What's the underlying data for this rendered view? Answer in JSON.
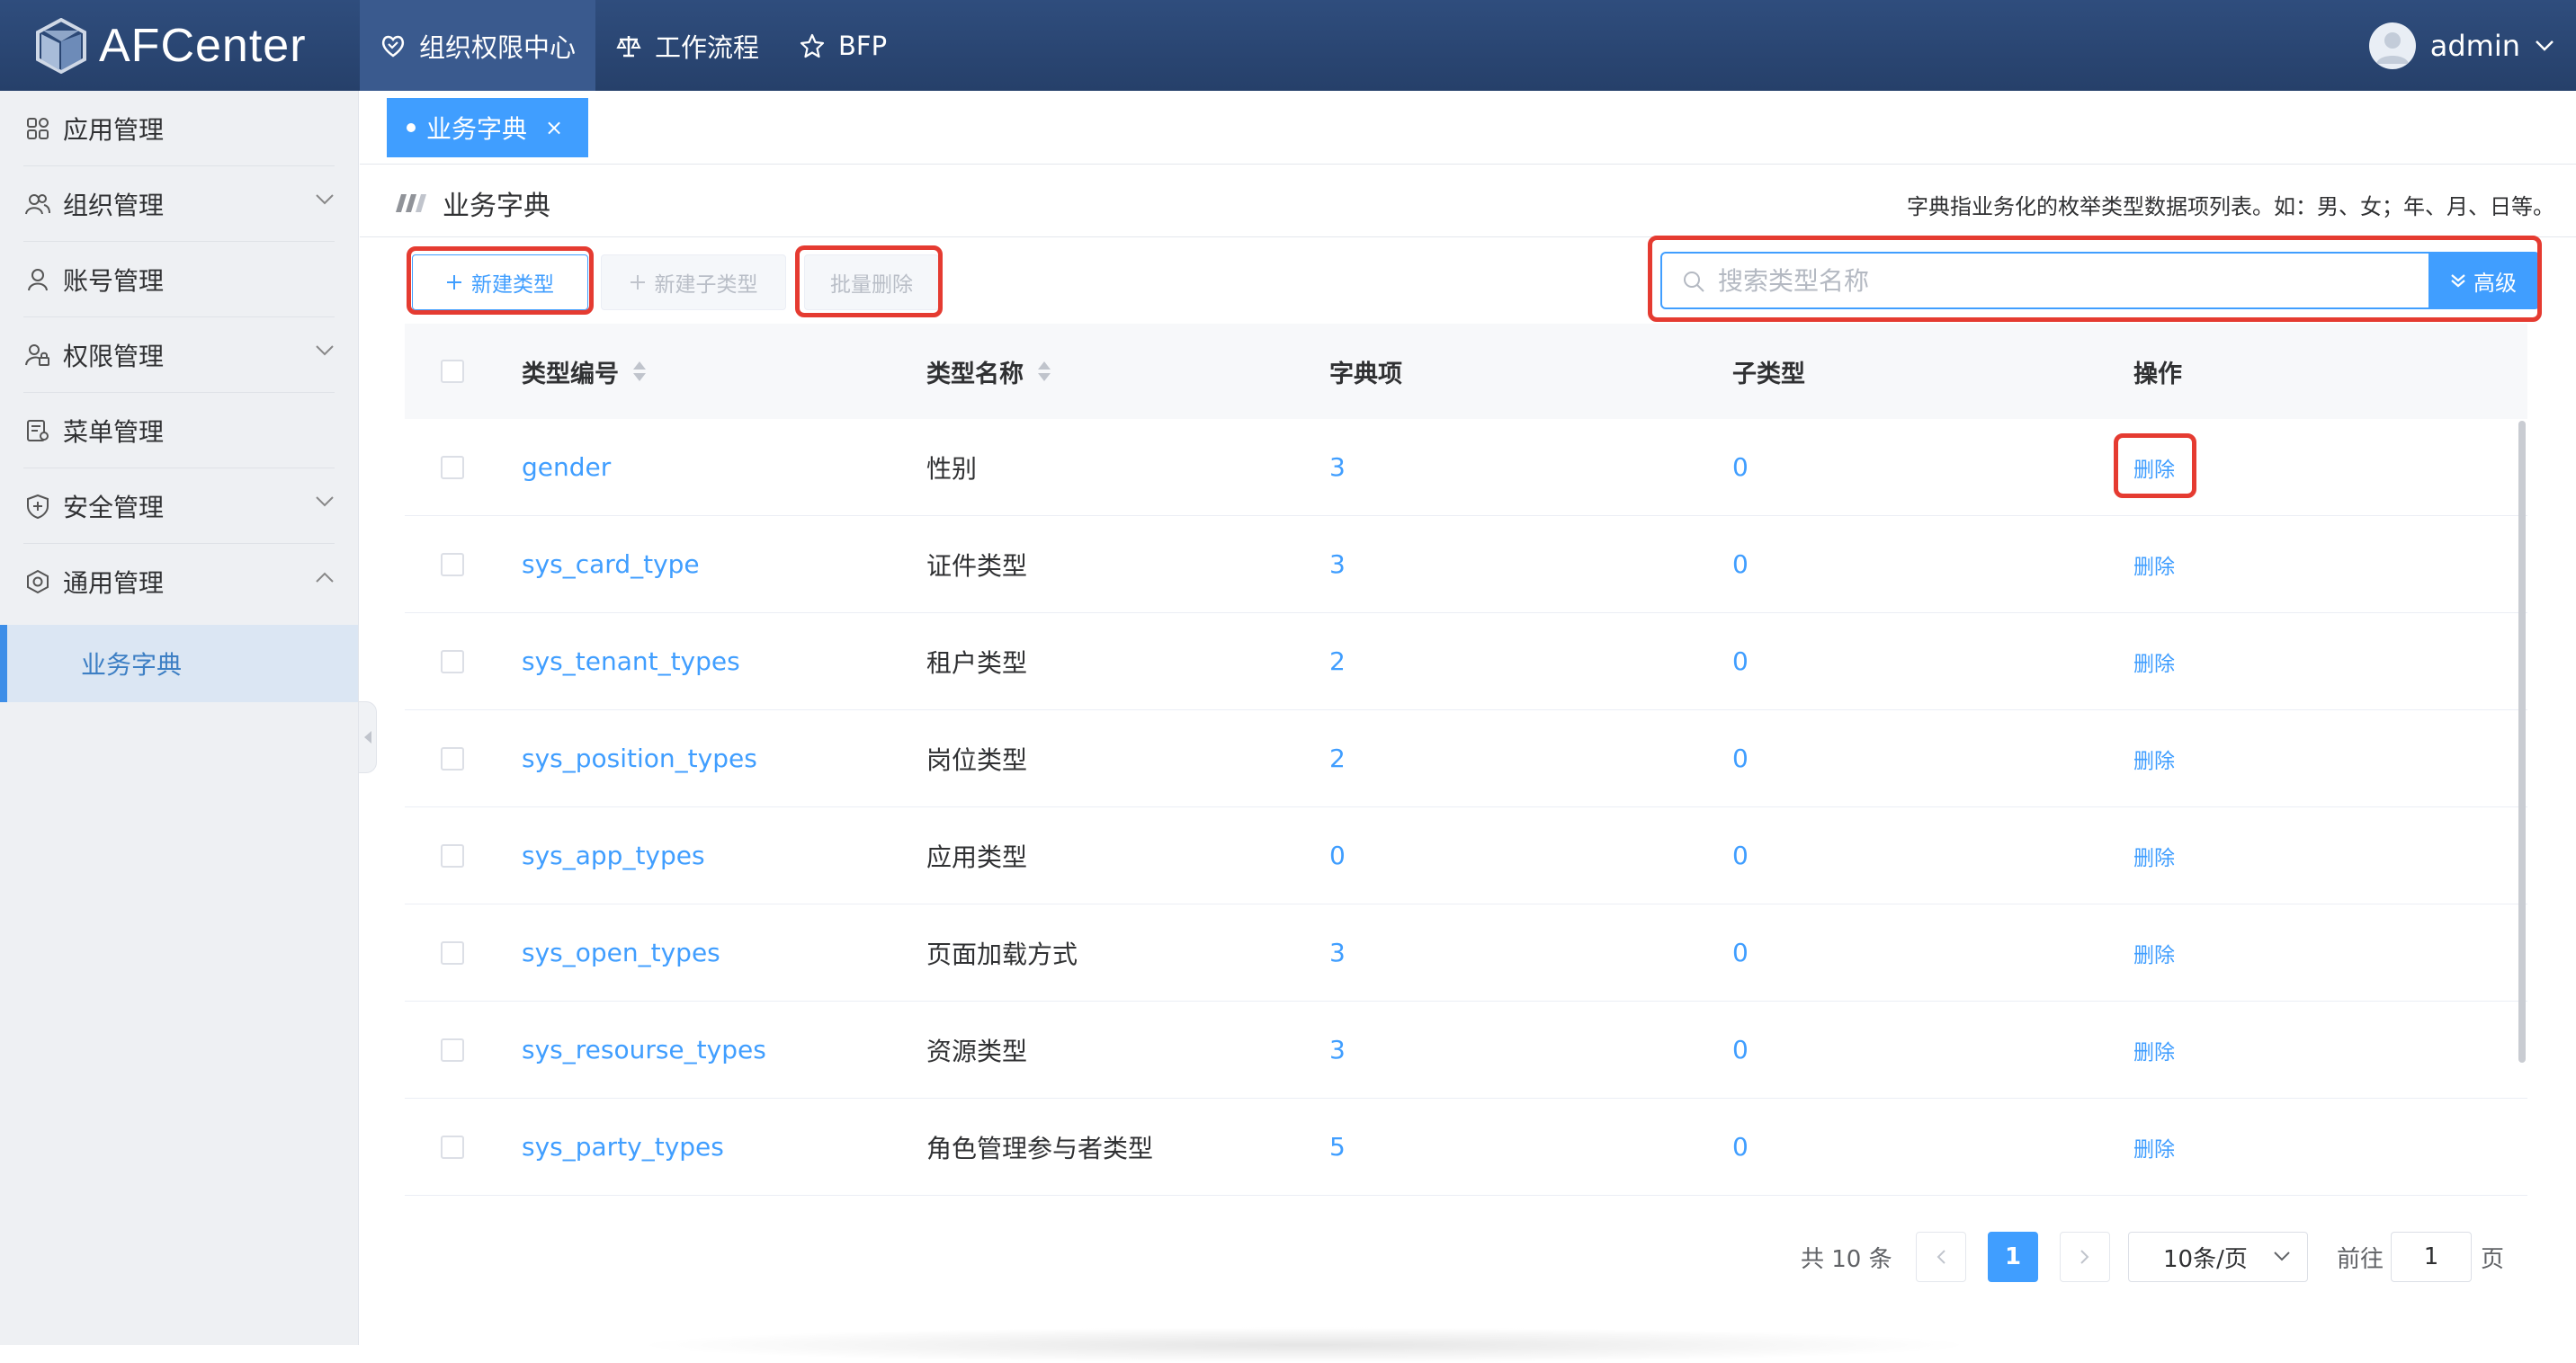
{
  "app": {
    "name": "AFCenter",
    "logo_icon": "afcenter-cube-logo"
  },
  "top_nav": [
    {
      "label": "组织权限中心",
      "icon": "heart-shield-icon",
      "active": true
    },
    {
      "label": "工作流程",
      "icon": "scale-icon",
      "active": false
    },
    {
      "label": "BFP",
      "icon": "star-icon",
      "active": false
    }
  ],
  "user": {
    "name": "admin"
  },
  "sidebar": {
    "items": [
      {
        "label": "应用管理",
        "icon": "grid-icon",
        "expandable": false
      },
      {
        "label": "组织管理",
        "icon": "users-icon",
        "expandable": true,
        "expanded": false
      },
      {
        "label": "账号管理",
        "icon": "user-icon",
        "expandable": false
      },
      {
        "label": "权限管理",
        "icon": "user-lock-icon",
        "expandable": true,
        "expanded": false
      },
      {
        "label": "菜单管理",
        "icon": "menu-doc-icon",
        "expandable": false
      },
      {
        "label": "安全管理",
        "icon": "shield-plus-icon",
        "expandable": true,
        "expanded": false
      },
      {
        "label": "通用管理",
        "icon": "settings-icon",
        "expandable": true,
        "expanded": true
      }
    ],
    "sub_active": "业务字典"
  },
  "tabs": [
    {
      "label": "业务字典",
      "closable": true
    }
  ],
  "page": {
    "title": "业务字典",
    "description": "字典指业务化的枚举类型数据项列表。如：男、女；年、月、日等。"
  },
  "toolbar": {
    "new_type": "新建类型",
    "new_sub_type": "新建子类型",
    "batch_delete": "批量删除",
    "search_placeholder": "搜索类型名称",
    "advanced": "高级"
  },
  "table": {
    "columns": [
      "类型编号",
      "类型名称",
      "字典项",
      "子类型",
      "操作"
    ],
    "rows": [
      {
        "code": "gender",
        "name": "性别",
        "items": "3",
        "sub": "0",
        "op": "删除"
      },
      {
        "code": "sys_card_type",
        "name": "证件类型",
        "items": "3",
        "sub": "0",
        "op": "删除"
      },
      {
        "code": "sys_tenant_types",
        "name": "租户类型",
        "items": "2",
        "sub": "0",
        "op": "删除"
      },
      {
        "code": "sys_position_types",
        "name": "岗位类型",
        "items": "2",
        "sub": "0",
        "op": "删除"
      },
      {
        "code": "sys_app_types",
        "name": "应用类型",
        "items": "0",
        "sub": "0",
        "op": "删除"
      },
      {
        "code": "sys_open_types",
        "name": "页面加载方式",
        "items": "3",
        "sub": "0",
        "op": "删除"
      },
      {
        "code": "sys_resourse_types",
        "name": "资源类型",
        "items": "3",
        "sub": "0",
        "op": "删除"
      },
      {
        "code": "sys_party_types",
        "name": "角色管理参与者类型",
        "items": "5",
        "sub": "0",
        "op": "删除"
      }
    ]
  },
  "pagination": {
    "total_text": "共 10 条",
    "current_page": "1",
    "page_size": "10条/页",
    "goto_label": "前往",
    "goto_value": "1",
    "page_suffix": "页"
  },
  "colors": {
    "accent": "#409eff",
    "header_bg": "#2b4674",
    "highlight_red": "#e53b31"
  }
}
